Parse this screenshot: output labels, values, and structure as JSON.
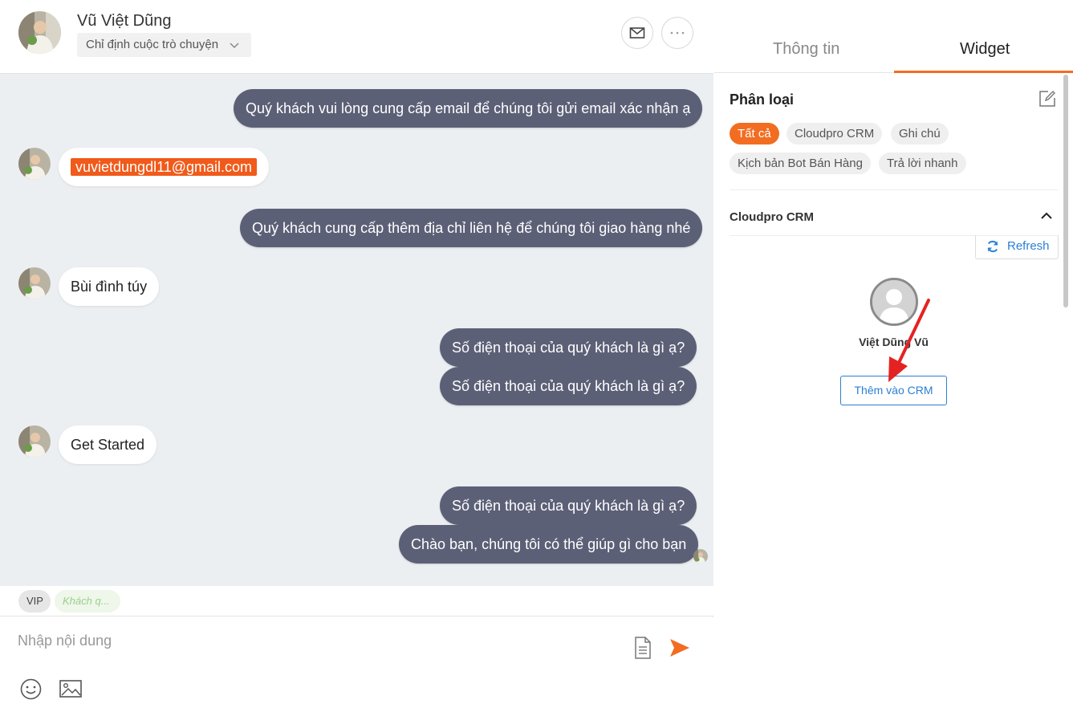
{
  "header": {
    "contact_name": "Vũ Việt Dũng",
    "assign_label": "Chỉ định cuộc trò chuyện"
  },
  "messages": [
    {
      "direction": "out",
      "text": "Quý khách vui lòng cung cấp email để chúng tôi gửi email xác nhận ạ"
    },
    {
      "direction": "in",
      "text": "vuvietdungdl11@gmail.com"
    },
    {
      "direction": "out",
      "text": "Quý khách cung cấp thêm địa chỉ liên hệ để chúng tôi giao hàng nhé"
    },
    {
      "direction": "in",
      "text": "Bùi đình túy"
    },
    {
      "direction": "out",
      "text": "Số điện thoại của quý khách là gì ạ?"
    },
    {
      "direction": "out",
      "text": "Số điện thoại của quý khách là gì ạ?"
    },
    {
      "direction": "in",
      "text": "Get Started"
    },
    {
      "direction": "out",
      "text": "Số điện thoại của quý khách là gì ạ?"
    },
    {
      "direction": "out",
      "text": "Chào bạn, chúng tôi có thể giúp gì cho bạn"
    }
  ],
  "tags": {
    "vip": "VIP",
    "khach": "Khách q..."
  },
  "composer": {
    "placeholder": "Nhập nội dung"
  },
  "panel": {
    "tabs": [
      "Thông tin",
      "Widget"
    ],
    "active_tab": "Widget",
    "classification_title": "Phân loại",
    "filters": [
      "Tất cả",
      "Cloudpro CRM",
      "Ghi chú",
      "Kịch bản Bot Bán Hàng",
      "Trả lời nhanh"
    ],
    "active_filter": "Tất cả",
    "crm_section_title": "Cloudpro CRM",
    "refresh_label": "Refresh",
    "crm_contact_name": "Việt Dũng Vũ",
    "add_crm_label": "Thêm vào CRM"
  },
  "colors": {
    "accent": "#f26d21",
    "outgoing_bubble": "#5c6077",
    "link_blue": "#2a7fd4",
    "chat_bg": "#eceff2"
  },
  "icons": [
    "mail-icon",
    "more-icon",
    "chevron-down-icon",
    "document-icon",
    "send-icon",
    "emoji-icon",
    "image-icon",
    "edit-icon",
    "chevron-up-icon",
    "refresh-icon",
    "user-placeholder-icon"
  ]
}
